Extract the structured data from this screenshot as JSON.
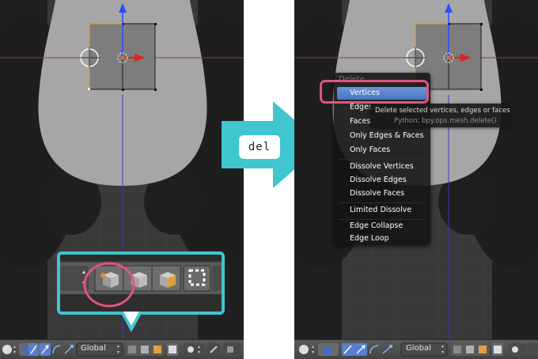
{
  "arrow": {
    "key_label": "del",
    "color": "#3fc6cf"
  },
  "bottom_bar": {
    "orientation_label": "Global"
  },
  "delete_menu": {
    "title": "Delete",
    "items": [
      {
        "label": "Vertices",
        "active": true
      },
      {
        "label": "Edges",
        "active": false
      },
      {
        "label": "Faces",
        "active": false
      },
      {
        "label": "Only Edges & Faces",
        "active": false
      },
      {
        "label": "Only Faces",
        "active": false
      },
      {
        "label": "Dissolve Vertices",
        "active": false
      },
      {
        "label": "Dissolve Edges",
        "active": false
      },
      {
        "label": "Dissolve Faces",
        "active": false
      },
      {
        "label": "Limited Dissolve",
        "active": false
      },
      {
        "label": "Edge Collapse",
        "active": false
      },
      {
        "label": "Edge Loop",
        "active": false
      }
    ]
  },
  "tooltip": {
    "description": "Delete selected vertices, edges or faces",
    "python": "Python: bpy.ops.mesh.delete()"
  },
  "colors": {
    "highlight_pink": "#e0547f",
    "callout_cyan": "#3fc6cf",
    "menu_active_blue": "#5a86cc",
    "viewport_bg": "#393939"
  }
}
